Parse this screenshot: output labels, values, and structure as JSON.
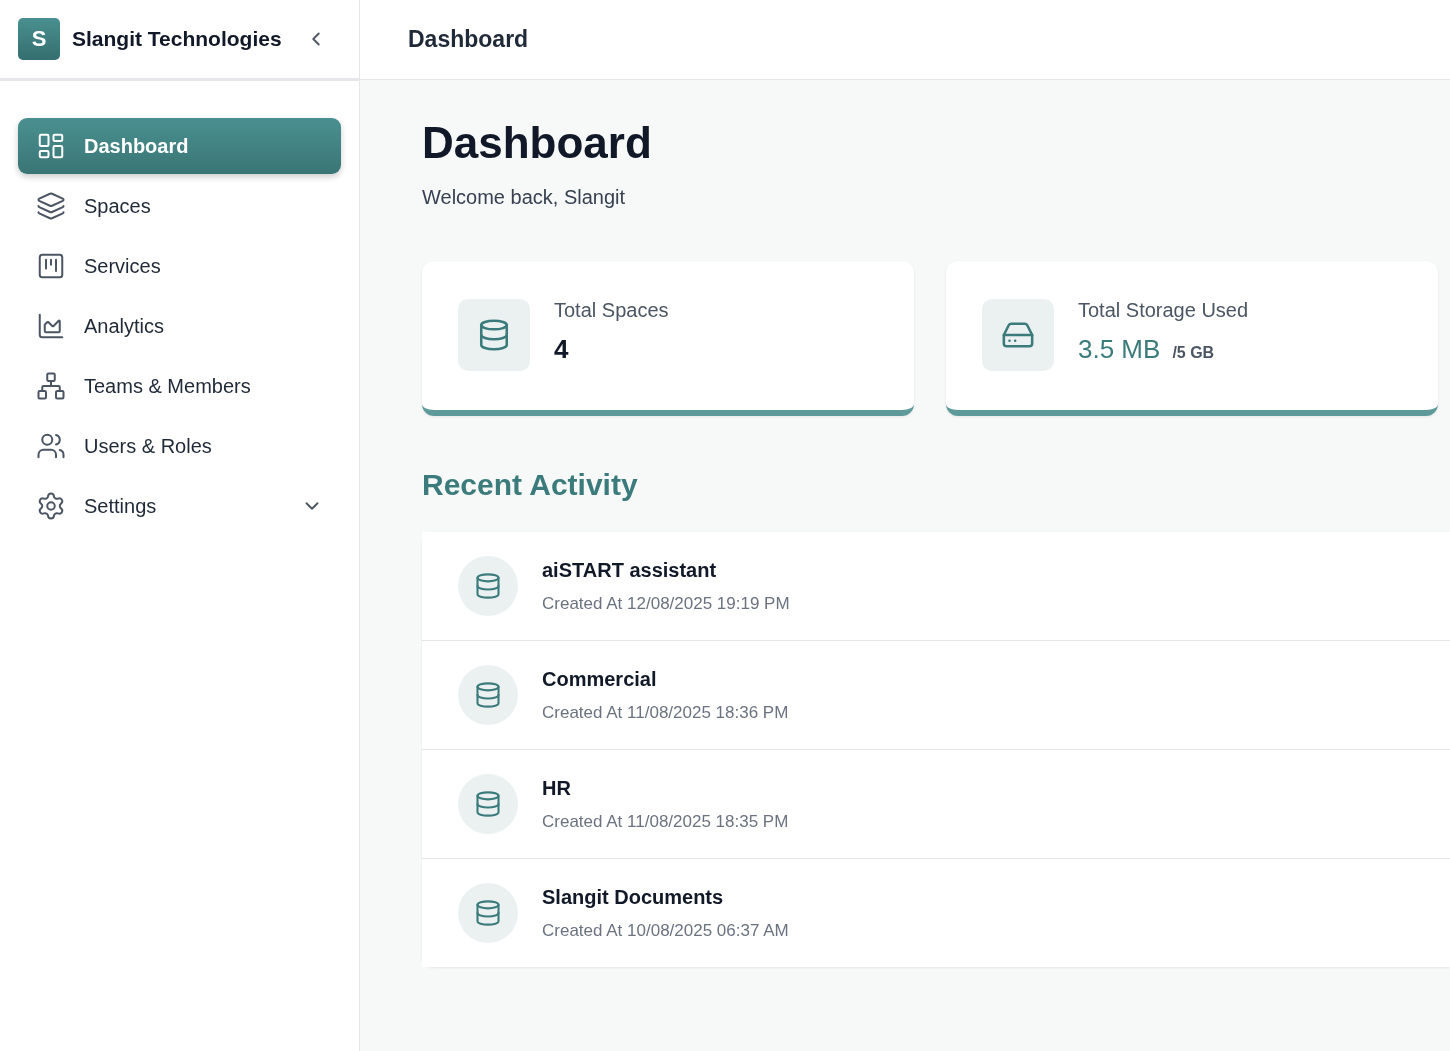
{
  "sidebar": {
    "brand": {
      "initial": "S",
      "name": "Slangit Technologies"
    },
    "items": [
      {
        "label": "Dashboard",
        "selected": true
      },
      {
        "label": "Spaces",
        "selected": false
      },
      {
        "label": "Services",
        "selected": false
      },
      {
        "label": "Analytics",
        "selected": false
      },
      {
        "label": "Teams & Members",
        "selected": false
      },
      {
        "label": "Users & Roles",
        "selected": false
      },
      {
        "label": "Settings",
        "selected": false,
        "expanded": false
      }
    ]
  },
  "header": {
    "title": "Dashboard"
  },
  "page": {
    "title": "Dashboard",
    "subtitle": "Welcome back, Slangit"
  },
  "stats": [
    {
      "kind": "count",
      "label": "Total Spaces",
      "value": "4"
    },
    {
      "kind": "storage",
      "label": "Total Storage Used",
      "value": "3.5 MB",
      "limit": "/5 GB"
    }
  ],
  "recent_activity": {
    "title": "Recent Activity",
    "items": [
      {
        "name": "aiSTART assistant",
        "created": "Created At 12/08/2025 19:19 PM"
      },
      {
        "name": "Commercial",
        "created": "Created At 11/08/2025 18:36 PM"
      },
      {
        "name": "HR",
        "created": "Created At 11/08/2025 18:35 PM"
      },
      {
        "name": "Slangit Documents",
        "created": "Created At 10/08/2025 06:37 AM"
      }
    ]
  }
}
